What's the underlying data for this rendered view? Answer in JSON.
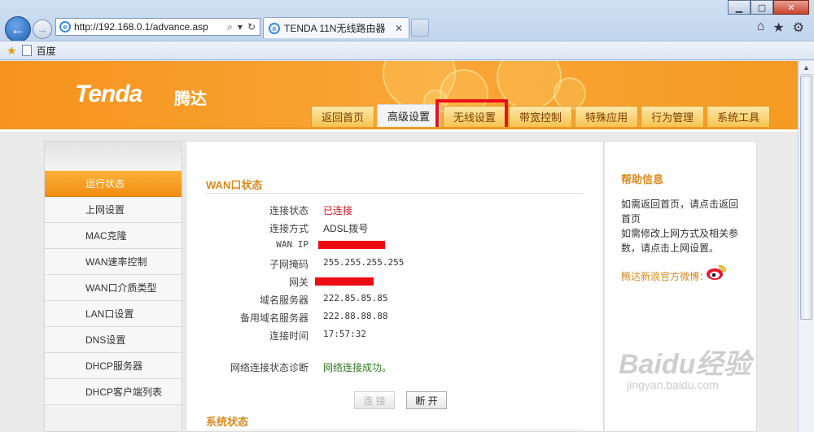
{
  "browser": {
    "url": "http://192.168.0.1/advance.asp",
    "tab_title": "TENDA 11N无线路由器",
    "favorites": [
      "百度"
    ],
    "window_controls": [
      "minimize",
      "maximize",
      "close"
    ],
    "toolbar_icons": [
      "home-icon",
      "star-icon",
      "gear-icon"
    ]
  },
  "header": {
    "logo_en": "Tenda",
    "logo_cn": "腾达",
    "tabs": [
      {
        "label": "返回首页"
      },
      {
        "label": "高级设置",
        "active": true
      },
      {
        "label": "无线设置",
        "highlighted": true
      },
      {
        "label": "带宽控制"
      },
      {
        "label": "特殊应用"
      },
      {
        "label": "行为管理"
      },
      {
        "label": "系统工具"
      }
    ]
  },
  "sidebar": {
    "items": [
      {
        "label": "运行状态",
        "active": true
      },
      {
        "label": "上网设置"
      },
      {
        "label": "MAC克隆"
      },
      {
        "label": "WAN速率控制"
      },
      {
        "label": "WAN口介质类型"
      },
      {
        "label": "LAN口设置"
      },
      {
        "label": "DNS设置"
      },
      {
        "label": "DHCP服务器"
      },
      {
        "label": "DHCP客户端列表"
      }
    ]
  },
  "wan_status": {
    "title": "WAN口状态",
    "rows": [
      {
        "label": "连接状态",
        "value": "已连接"
      },
      {
        "label": "连接方式",
        "value": "ADSL拨号"
      },
      {
        "label": "WAN IP",
        "value": ""
      },
      {
        "label": "子网掩码",
        "value": "255.255.255.255"
      },
      {
        "label": "网关",
        "value": ""
      },
      {
        "label": "域名服务器",
        "value": "222.85.85.85"
      },
      {
        "label": "备用域名服务器",
        "value": "222.88.88.88"
      },
      {
        "label": "连接时间",
        "value": "17:57:32"
      }
    ],
    "diagnosis_label": "网络连接状态诊断",
    "diagnosis_value": "网络连接成功。",
    "connect_button": "连 接",
    "disconnect_button": "断 开"
  },
  "system_status": {
    "title": "系统状态"
  },
  "help": {
    "title": "帮助信息",
    "line1": "如需返回首页，请点击返回首页",
    "line2": "如需修改上网方式及相关参数，请点击上网设置。",
    "weibo_label": "腾达新浪官方微博："
  },
  "watermark": {
    "main": "Baidu经验",
    "sub": "jingyan.baidu.com"
  },
  "colors": {
    "header_orange": "#f7941d",
    "accent_text": "#d9891c",
    "status_red": "#c8161d",
    "success_green": "#2e7d1c",
    "highlight_red": "#e8101b"
  }
}
